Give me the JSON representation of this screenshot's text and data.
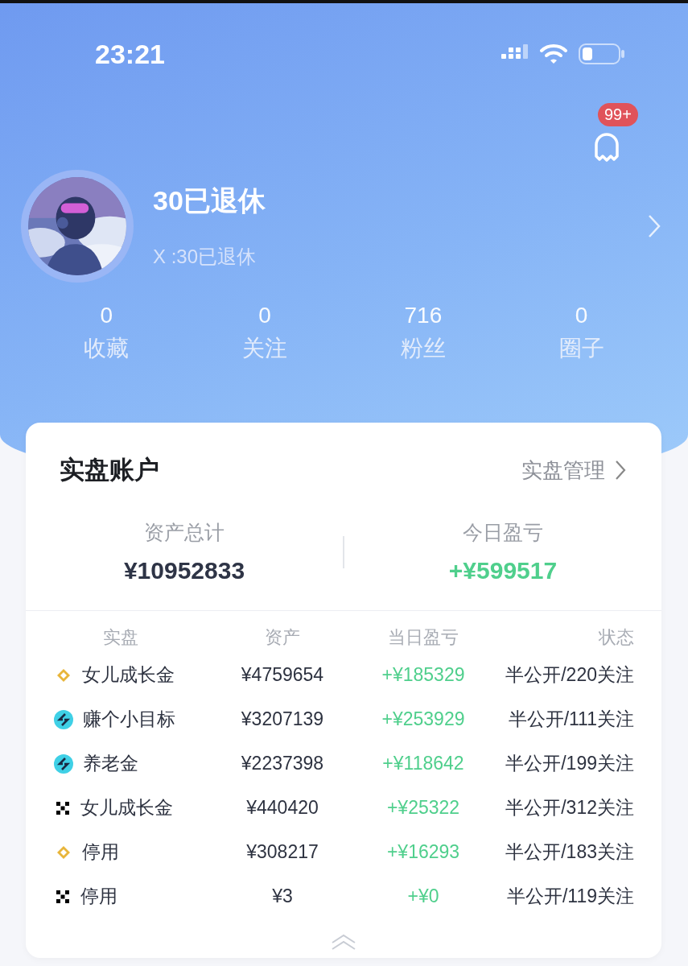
{
  "status_bar": {
    "time": "23:21"
  },
  "notifications": {
    "badge": "99+"
  },
  "profile": {
    "name": "30已退休",
    "handle": "X :30已退休"
  },
  "stats": [
    {
      "value": "0",
      "label": "收藏"
    },
    {
      "value": "0",
      "label": "关注"
    },
    {
      "value": "716",
      "label": "粉丝"
    },
    {
      "value": "0",
      "label": "圈子"
    }
  ],
  "account_card": {
    "title": "实盘账户",
    "manage_link": "实盘管理",
    "total_assets": {
      "label": "资产总计",
      "value": "¥10952833"
    },
    "today_pnl": {
      "label": "今日盈亏",
      "value": "+¥599517"
    },
    "columns": [
      "实盘",
      "资产",
      "当日盈亏",
      "状态"
    ],
    "rows": [
      {
        "kind": "diamond",
        "name": "女儿成长金",
        "assets": "¥4759654",
        "pnl": "+¥185329",
        "status": "半公开/220关注"
      },
      {
        "kind": "swirl",
        "name": "赚个小目标",
        "assets": "¥3207139",
        "pnl": "+¥253929",
        "status": "半公开/111关注"
      },
      {
        "kind": "swirl",
        "name": "养老金",
        "assets": "¥2237398",
        "pnl": "+¥118642",
        "status": "半公开/199关注"
      },
      {
        "kind": "checker",
        "name": "女儿成长金",
        "assets": "¥440420",
        "pnl": "+¥25322",
        "status": "半公开/312关注"
      },
      {
        "kind": "diamond",
        "name": "停用",
        "assets": "¥308217",
        "pnl": "+¥16293",
        "status": "半公开/183关注"
      },
      {
        "kind": "checker",
        "name": "停用",
        "assets": "¥3",
        "pnl": "+¥0",
        "status": "半公开/119关注"
      }
    ]
  }
}
